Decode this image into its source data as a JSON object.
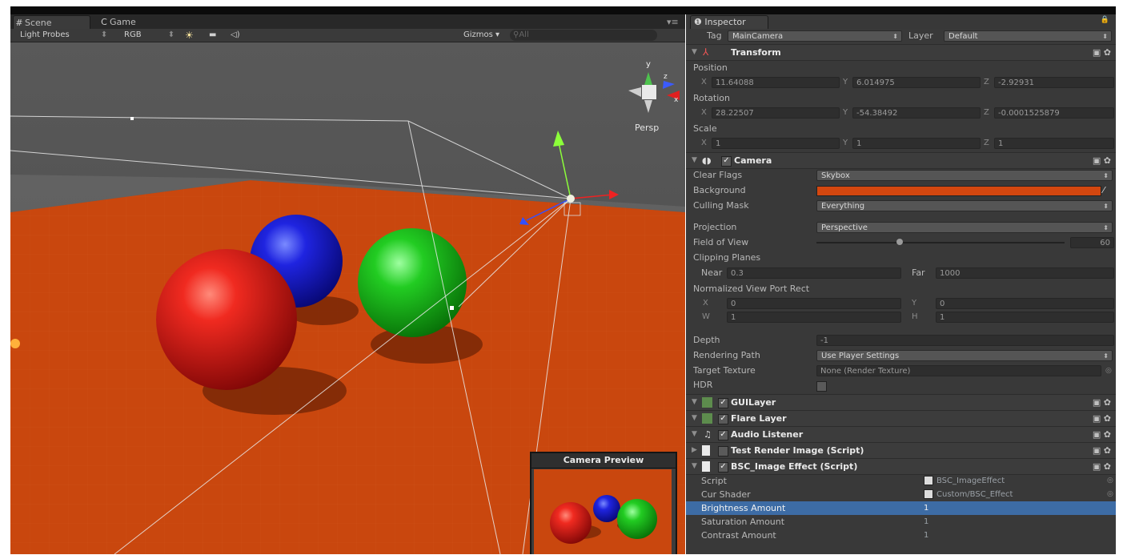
{
  "scene": {
    "tabs": [
      {
        "icon": "#",
        "label": "Scene"
      },
      {
        "icon": "C",
        "label": "Game"
      }
    ],
    "toolbar": {
      "render_mode": "Light Probes",
      "color_mode": "RGB",
      "gizmos": "Gizmos",
      "search_placeholder": "All"
    },
    "view_label": "Persp",
    "camera_preview_title": "Camera Preview"
  },
  "inspector": {
    "tab_label": "Inspector",
    "tag_label": "Tag",
    "tag_value": "MainCamera",
    "layer_label": "Layer",
    "layer_value": "Default",
    "transform": {
      "name": "Transform",
      "position_label": "Position",
      "position": {
        "x": "11.64088",
        "y": "6.014975",
        "z": "-2.92931"
      },
      "rotation_label": "Rotation",
      "rotation": {
        "x": "28.22507",
        "y": "-54.38492",
        "z": "-0.0001525879"
      },
      "scale_label": "Scale",
      "scale": {
        "x": "1",
        "y": "1",
        "z": "1"
      }
    },
    "camera": {
      "name": "Camera",
      "clear_flags_label": "Clear Flags",
      "clear_flags": "Skybox",
      "background_label": "Background",
      "background_color": "#d4470f",
      "culling_mask_label": "Culling Mask",
      "culling_mask": "Everything",
      "projection_label": "Projection",
      "projection": "Perspective",
      "fov_label": "Field of View",
      "fov": "60",
      "clipping_label": "Clipping Planes",
      "near_label": "Near",
      "near": "0.3",
      "far_label": "Far",
      "far": "1000",
      "viewport_label": "Normalized View Port Rect",
      "vp_x": "0",
      "vp_y": "0",
      "vp_w": "1",
      "vp_h": "1",
      "depth_label": "Depth",
      "depth": "-1",
      "rendering_path_label": "Rendering Path",
      "rendering_path": "Use Player Settings",
      "target_texture_label": "Target Texture",
      "target_texture": "None (Render Texture)",
      "hdr_label": "HDR"
    },
    "components": [
      {
        "name": "GUILayer"
      },
      {
        "name": "Flare Layer"
      },
      {
        "name": "Audio Listener"
      },
      {
        "name": "Test Render Image (Script)"
      },
      {
        "name": "BSC_Image Effect (Script)"
      }
    ],
    "bsc": {
      "script_label": "Script",
      "script_value": "BSC_ImageEffect",
      "shader_label": "Cur Shader",
      "shader_value": "Custom/BSC_Effect",
      "brightness_label": "Brightness Amount",
      "brightness": "1",
      "saturation_label": "Saturation Amount",
      "saturation": "1",
      "contrast_label": "Contrast Amount",
      "contrast": "1"
    }
  },
  "colors": {
    "ground": "#c9470e",
    "red_sphere": "#e01a1a",
    "blue_sphere": "#1a22dd",
    "green_sphere": "#1ec21e",
    "highlight": "#3d6ca5"
  }
}
